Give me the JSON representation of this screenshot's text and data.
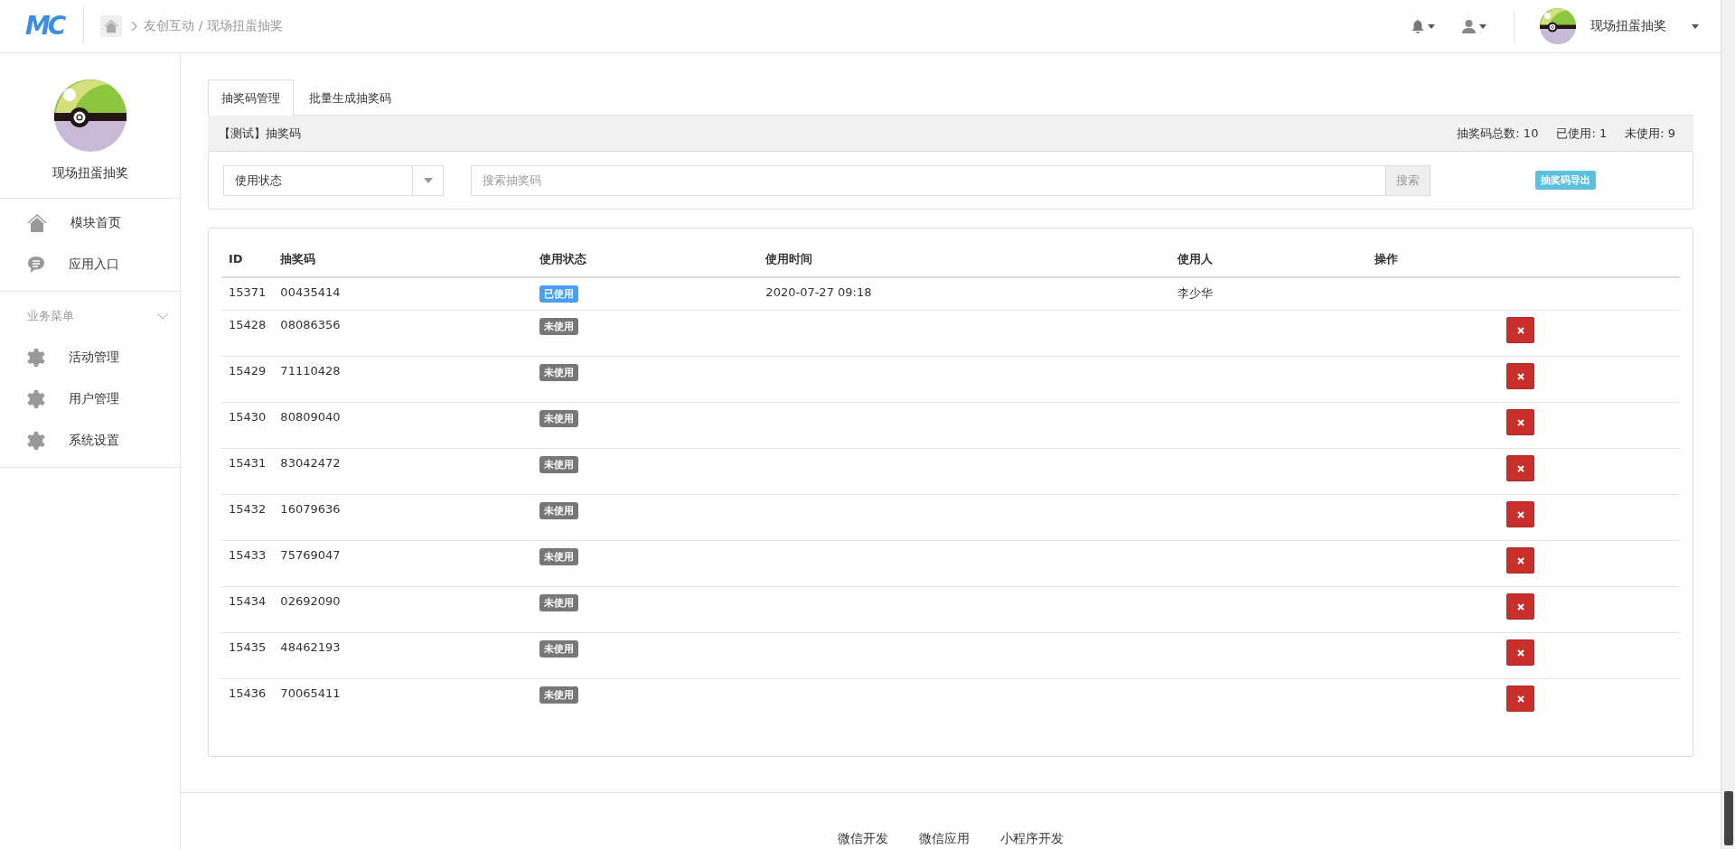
{
  "topbar": {
    "logo": "MC",
    "breadcrumb": [
      {
        "label": "友创互动"
      },
      {
        "label": "现场扭蛋抽奖"
      }
    ],
    "breadcrumb_separator": "/",
    "account_name": "现场扭蛋抽奖"
  },
  "sidebar": {
    "title": "现场扭蛋抽奖",
    "items": [
      {
        "label": "模块首页",
        "kind": "home"
      },
      {
        "label": "应用入口",
        "kind": "chat"
      }
    ],
    "group": {
      "label": "业务菜单",
      "expanded": true,
      "items": [
        {
          "label": "活动管理",
          "kind": "gear"
        },
        {
          "label": "用户管理",
          "kind": "gear"
        },
        {
          "label": "系统设置",
          "kind": "gear"
        }
      ]
    }
  },
  "tabs": [
    {
      "label": "抽奖码管理",
      "selected": true
    },
    {
      "label": "批量生成抽奖码",
      "selected": false
    }
  ],
  "panel": {
    "title": "【测试】抽奖码",
    "stats": [
      {
        "label": "抽奖码总数:",
        "value": "10"
      },
      {
        "label": "已使用:",
        "value": "1"
      },
      {
        "label": "未使用:",
        "value": "9"
      }
    ]
  },
  "filters": {
    "status_select": "使用状态",
    "search": {
      "placeholder": "搜索抽奖码"
    },
    "search_button": "搜索",
    "export_button": "抽奖码导出"
  },
  "table": {
    "columns": [
      "ID",
      "抽奖码",
      "使用状态",
      "使用时间",
      "使用人",
      "操作"
    ],
    "rows": [
      {
        "id": "15371",
        "code": "00435414",
        "status": "已使用",
        "used": true,
        "time": "2020-07-27 09:18",
        "user": "李少华",
        "deletable": false
      },
      {
        "id": "15428",
        "code": "08086356",
        "status": "未使用",
        "used": false,
        "deletable": true
      },
      {
        "id": "15429",
        "code": "71110428",
        "status": "未使用",
        "used": false,
        "deletable": true
      },
      {
        "id": "15430",
        "code": "80809040",
        "status": "未使用",
        "used": false,
        "deletable": true
      },
      {
        "id": "15431",
        "code": "83042472",
        "status": "未使用",
        "used": false,
        "deletable": true
      },
      {
        "id": "15432",
        "code": "16079636",
        "status": "未使用",
        "used": false,
        "deletable": true
      },
      {
        "id": "15433",
        "code": "75769047",
        "status": "未使用",
        "used": false,
        "deletable": true
      },
      {
        "id": "15434",
        "code": "02692090",
        "status": "未使用",
        "used": false,
        "deletable": true
      },
      {
        "id": "15435",
        "code": "48462193",
        "status": "未使用",
        "used": false,
        "deletable": true
      },
      {
        "id": "15436",
        "code": "70065411",
        "status": "未使用",
        "used": false,
        "deletable": true
      }
    ]
  },
  "footer": {
    "links": [
      "微信开发",
      "微信应用",
      "小程序开发"
    ]
  }
}
